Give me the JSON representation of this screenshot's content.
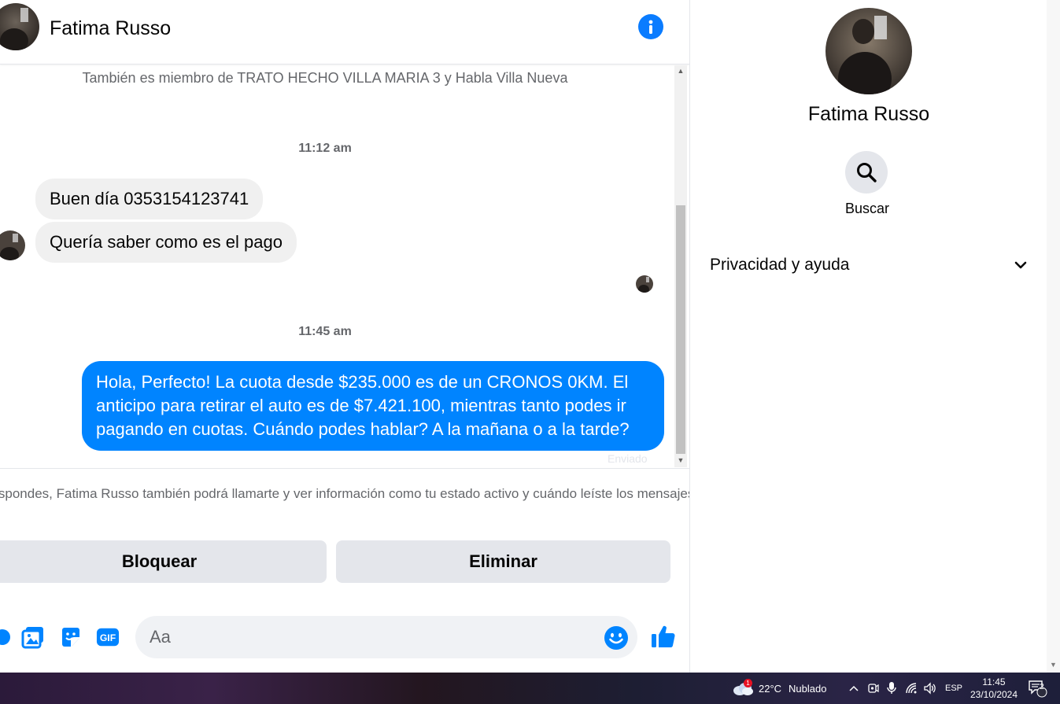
{
  "contact": {
    "name": "Fatima Russo"
  },
  "conversation": {
    "member_note": "También es miembro de TRATO HECHO VILLA MARIA 3 y Habla Villa Nueva",
    "messages": [
      {
        "time": "11:12 am",
        "direction": "in",
        "text": "Buen día  0353154123741"
      },
      {
        "direction": "in",
        "text": "Quería saber como es el pago"
      },
      {
        "time": "11:45 am",
        "direction": "out",
        "text": "Hola, Perfecto! La cuota desde $235.000 es de un CRONOS 0KM. El anticipo para retirar el auto es de $7.421.100, mientras tanto podes ir pagando en cuotas. Cuándo podes hablar? A la mañana o a la tarde?"
      }
    ],
    "sent_status": "Enviado"
  },
  "request_notice": "Si respondes, Fatima Russo también podrá llamarte y ver información como tu estado activo y cuándo leíste los mensajes.",
  "actions": {
    "block_label": "Bloquear",
    "delete_label": "Eliminar"
  },
  "composer": {
    "placeholder": "Aa",
    "icons": [
      "plus-icon",
      "image-icon",
      "sticker-icon",
      "gif-icon",
      "emoji-icon",
      "like-icon"
    ],
    "gif_label": "GIF"
  },
  "info_panel": {
    "search_label": "Buscar",
    "privacy_label": "Privacidad y ayuda"
  },
  "taskbar": {
    "weather_temp": "22°C",
    "weather_desc": "Nublado",
    "weather_alerts": "1",
    "language": "ESP",
    "time": "11:45",
    "date": "23/10/2024",
    "notifications": "2"
  },
  "colors": {
    "accent": "#0084ff",
    "info_icon": "#0a7cff",
    "incoming_bubble": "#f0f0f0",
    "button_bg": "#e4e6eb"
  }
}
